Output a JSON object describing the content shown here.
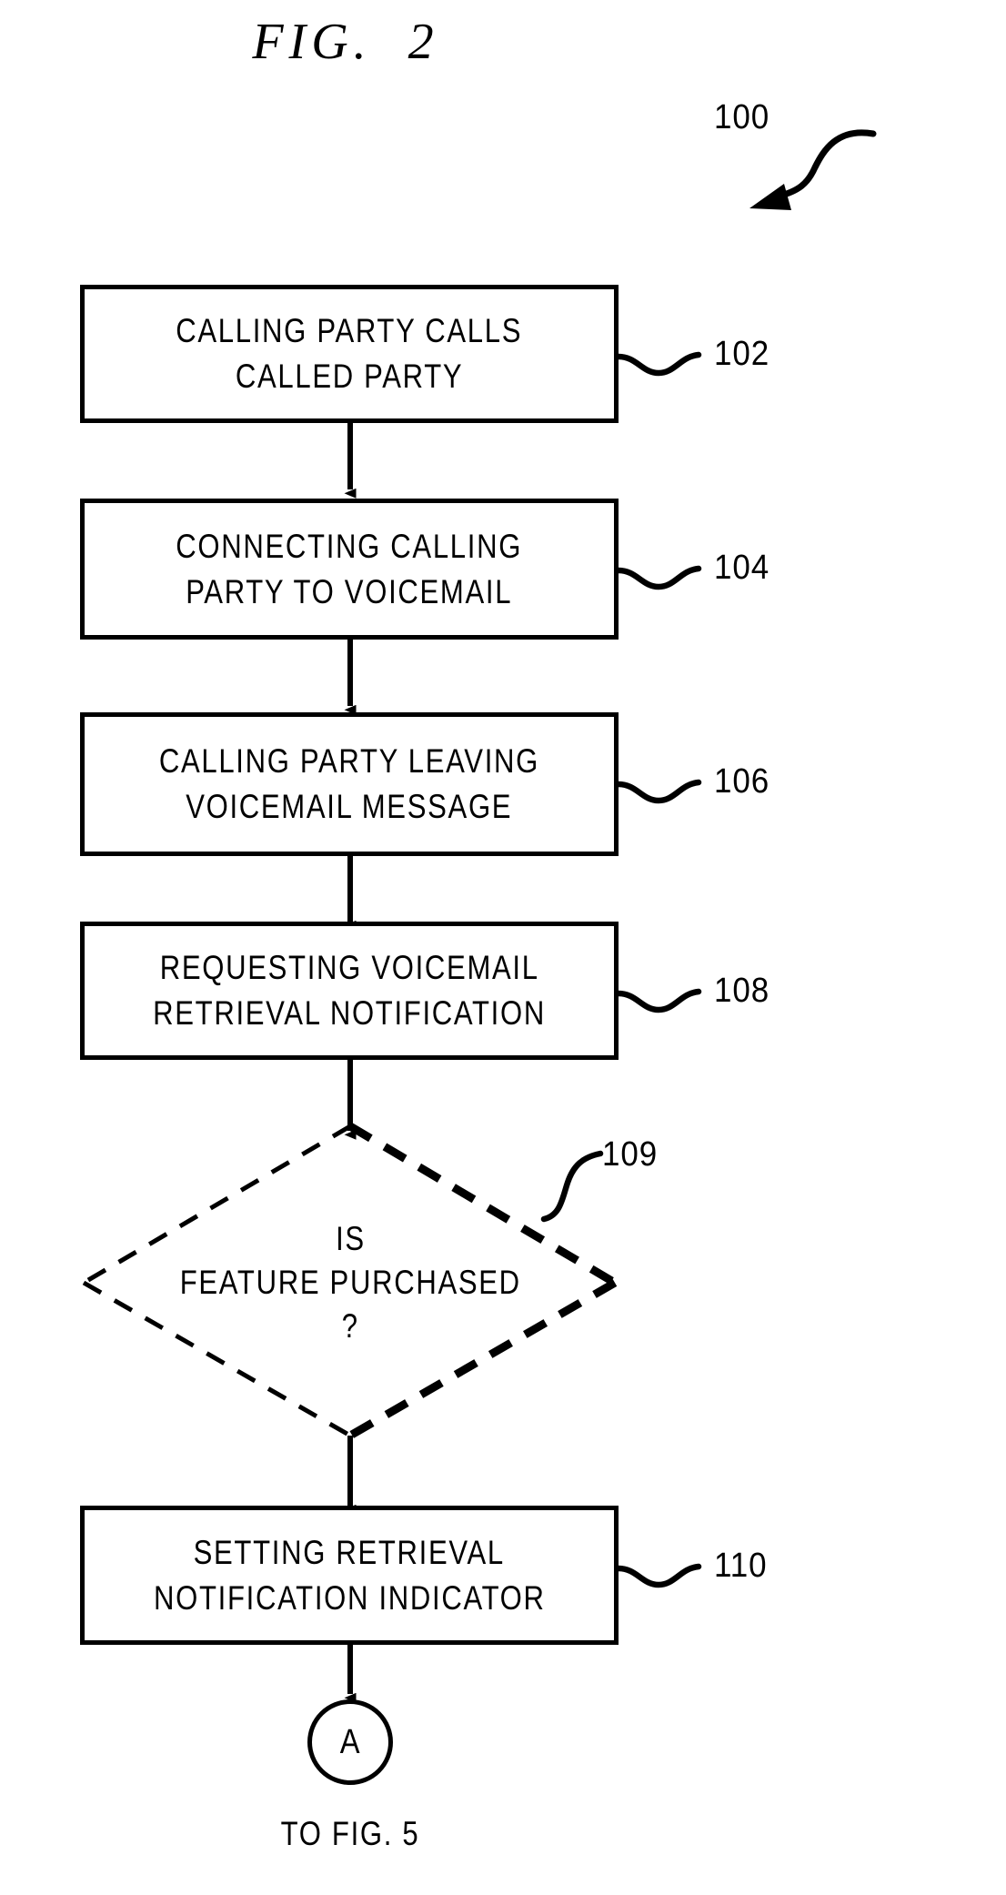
{
  "figure": {
    "title": "FIG.  2",
    "diagram_ref": "100",
    "bottom_caption": "TO FIG. 5",
    "connector_label": "A"
  },
  "nodes": [
    {
      "ref": "102",
      "shape": "rectangle",
      "lines": [
        "CALLING PARTY CALLS",
        "CALLED PARTY"
      ]
    },
    {
      "ref": "104",
      "shape": "rectangle",
      "lines": [
        "CONNECTING CALLING",
        "PARTY TO VOICEMAIL"
      ]
    },
    {
      "ref": "106",
      "shape": "rectangle",
      "lines": [
        "CALLING PARTY LEAVING",
        "VOICEMAIL MESSAGE"
      ]
    },
    {
      "ref": "108",
      "shape": "rectangle",
      "lines": [
        "REQUESTING VOICEMAIL",
        "RETRIEVAL NOTIFICATION"
      ]
    },
    {
      "ref": "109",
      "shape": "diamond-dashed",
      "lines": [
        "IS",
        "FEATURE PURCHASED",
        "?"
      ]
    },
    {
      "ref": "110",
      "shape": "rectangle",
      "lines": [
        "SETTING RETRIEVAL",
        "NOTIFICATION INDICATOR"
      ]
    }
  ],
  "colors": {
    "ink": "#000000",
    "paper": "#ffffff"
  }
}
